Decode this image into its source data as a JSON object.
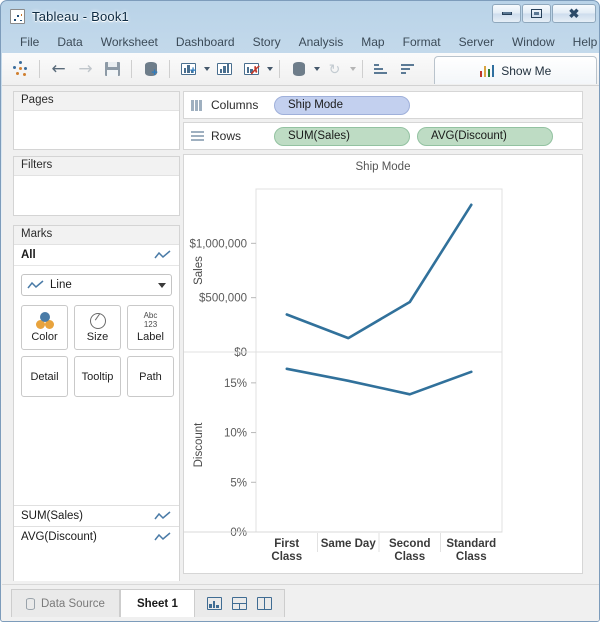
{
  "window": {
    "title": "Tableau - Book1",
    "app_icon": "tableau-logo-icon",
    "controls": {
      "minimize": "minimize",
      "restore": "restore",
      "close": "close"
    }
  },
  "menubar": {
    "items": [
      {
        "label": "File"
      },
      {
        "label": "Data"
      },
      {
        "label": "Worksheet"
      },
      {
        "label": "Dashboard"
      },
      {
        "label": "Story"
      },
      {
        "label": "Analysis"
      },
      {
        "label": "Map"
      },
      {
        "label": "Format"
      },
      {
        "label": "Server"
      },
      {
        "label": "Window"
      },
      {
        "label": "Help"
      }
    ]
  },
  "toolbar": {
    "buttons": [
      {
        "name": "tableau-home-icon"
      },
      {
        "name": "undo-arrow-icon"
      },
      {
        "name": "redo-arrow-icon"
      },
      {
        "name": "save-icon"
      },
      {
        "name": "new-data-source-icon"
      },
      {
        "name": "new-worksheet-icon"
      },
      {
        "name": "duplicate-sheet-icon"
      },
      {
        "name": "clear-sheet-icon"
      },
      {
        "name": "swap-data-icon"
      },
      {
        "name": "refresh-icon"
      },
      {
        "name": "sort-ascending-icon"
      },
      {
        "name": "sort-descending-icon"
      }
    ],
    "show_me": {
      "label": "Show Me",
      "icon": "bar-chart-icon"
    }
  },
  "sidebar": {
    "pages": {
      "title": "Pages"
    },
    "filters": {
      "title": "Filters"
    },
    "marks": {
      "title": "Marks",
      "all_label": "All",
      "mark_type": "Line",
      "mark_type_icon": "line-chart-icon",
      "buttons": [
        {
          "label": "Color",
          "icon": "color-palette-icon"
        },
        {
          "label": "Size",
          "icon": "size-circle-icon"
        },
        {
          "label": "Label",
          "icon": "abc-123-icon"
        },
        {
          "label": "Detail",
          "icon": "detail-icon"
        },
        {
          "label": "Tooltip",
          "icon": "tooltip-icon"
        },
        {
          "label": "Path",
          "icon": "path-icon"
        }
      ],
      "measures": [
        {
          "label": "SUM(Sales)",
          "icon": "line-chart-icon"
        },
        {
          "label": "AVG(Discount)",
          "icon": "line-chart-icon"
        }
      ]
    }
  },
  "shelves": {
    "columns": {
      "label": "Columns",
      "icon": "columns-icon",
      "pills": [
        {
          "label": "Ship Mode",
          "type": "dimension"
        }
      ]
    },
    "rows": {
      "label": "Rows",
      "icon": "rows-icon",
      "pills": [
        {
          "label": "SUM(Sales)",
          "type": "measure"
        },
        {
          "label": "AVG(Discount)",
          "type": "measure"
        }
      ]
    }
  },
  "statusbar": {
    "data_source_tab": {
      "label": "Data Source",
      "icon": "database-icon"
    },
    "sheet_tabs": [
      {
        "label": "Sheet 1",
        "active": true
      }
    ],
    "new_buttons": [
      {
        "name": "new-worksheet-icon"
      },
      {
        "name": "new-dashboard-icon"
      },
      {
        "name": "new-story-icon"
      }
    ]
  },
  "chart_data": [
    {
      "type": "line",
      "title": "Ship Mode",
      "xlabel": "",
      "ylabel": "Sales",
      "categories": [
        "First Class",
        "Same Day",
        "Second Class",
        "Standard Class"
      ],
      "values": [
        345000,
        128000,
        460000,
        1355000
      ],
      "ytick_labels": [
        "$1,000,000",
        "$500,000",
        "$0"
      ],
      "ytick_values": [
        1000000,
        500000,
        0
      ],
      "ylim": [
        0,
        1500000
      ],
      "grid": false,
      "line_color": "#31719B",
      "legend": "none"
    },
    {
      "type": "line",
      "title": "",
      "xlabel": "",
      "ylabel": "Discount",
      "categories": [
        "First Class",
        "Same Day",
        "Second Class",
        "Standard Class"
      ],
      "values": [
        0.1641,
        0.1521,
        0.1385,
        0.1611
      ],
      "ytick_labels": [
        "15%",
        "10%",
        "5%",
        "0%"
      ],
      "ytick_values": [
        0.15,
        0.1,
        0.05,
        0
      ],
      "ylim": [
        0,
        0.175
      ],
      "grid": false,
      "line_color": "#31719B",
      "legend": "none"
    }
  ]
}
